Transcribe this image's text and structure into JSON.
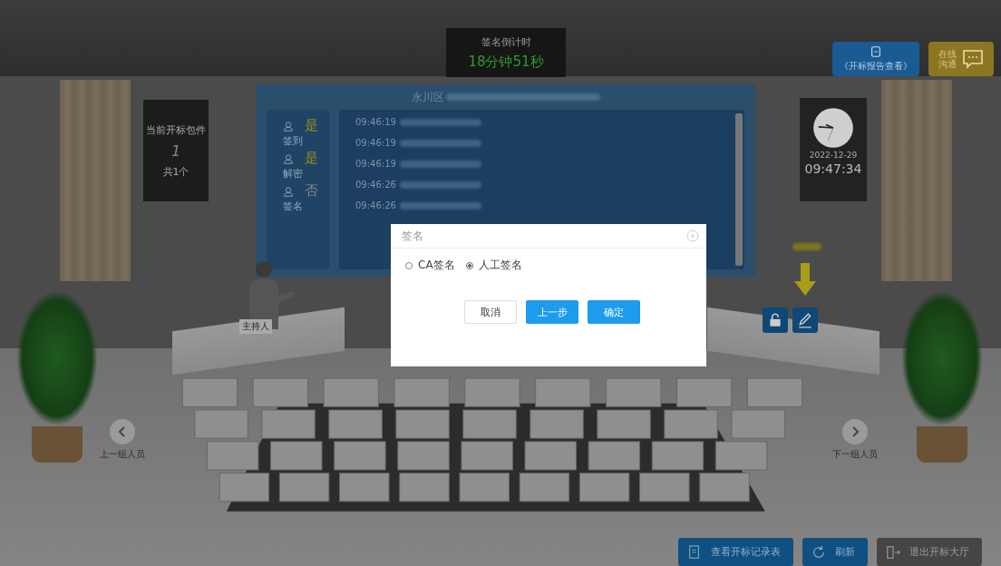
{
  "countdown": {
    "label": "签名倒计时",
    "value": "18分钟51秒"
  },
  "package_board": {
    "title": "当前开标包件",
    "number": "1",
    "total": "共1个"
  },
  "hall_screen": {
    "title": "永川区",
    "status": [
      {
        "value": "是",
        "label": "签到",
        "done": true
      },
      {
        "value": "是",
        "label": "解密",
        "done": true
      },
      {
        "value": "否",
        "label": "签名",
        "done": false
      }
    ],
    "log": [
      {
        "time": "09:46:19"
      },
      {
        "time": "09:46:19"
      },
      {
        "time": "09:46:19"
      },
      {
        "time": "09:46:26"
      },
      {
        "time": "09:46:26"
      }
    ]
  },
  "clock": {
    "date": "2022-12-29",
    "time": "09:47:34"
  },
  "top_buttons": [
    {
      "label": "《开标报告查看》",
      "kind": "report"
    },
    {
      "label": "在线沟通",
      "kind": "chat"
    }
  ],
  "host_sign": "主持人",
  "nav": [
    {
      "label": "上一组人员",
      "kind": "prev"
    },
    {
      "label": "下一组人员",
      "kind": "next"
    }
  ],
  "dialog": {
    "title": "签名",
    "options": [
      {
        "label": "CA签名",
        "selected": false
      },
      {
        "label": "人工签名",
        "selected": true
      }
    ],
    "buttons": [
      {
        "label": "取消",
        "kind": "default"
      },
      {
        "label": "上一步",
        "kind": "primary"
      },
      {
        "label": "确定",
        "kind": "primary"
      }
    ]
  },
  "bottom_buttons": [
    {
      "label": "查看开标记录表",
      "kind": "record"
    },
    {
      "label": "刷新",
      "kind": "refresh"
    },
    {
      "label": "退出开标大厅",
      "kind": "exit"
    }
  ]
}
